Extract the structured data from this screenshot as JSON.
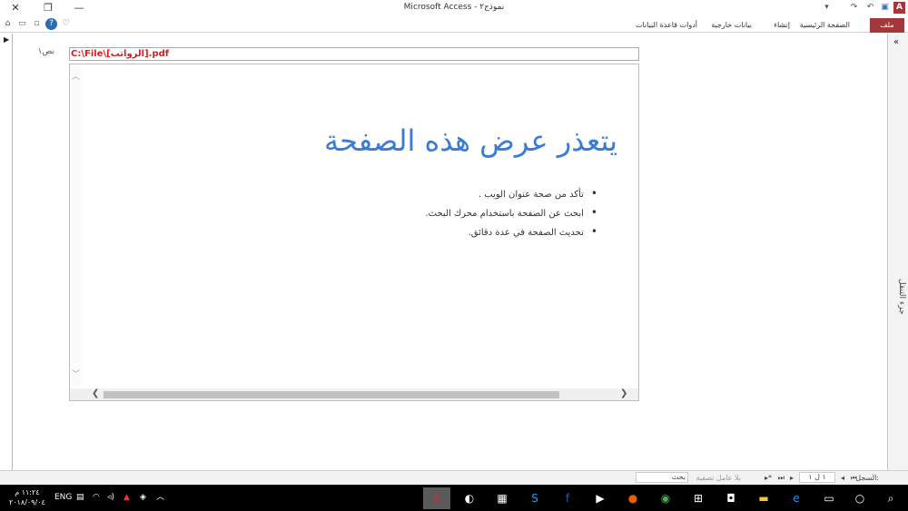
{
  "window": {
    "title": "Microsoft Access - نموذج٢"
  },
  "ribbon": {
    "tabs": [
      "ملف",
      "الصفحة الرئيسية",
      "إنشاء",
      "بيانات خارجية",
      "أدوات قاعدة البيانات"
    ]
  },
  "nav_pane": {
    "label": "جزء التنقل",
    "collapse": "«"
  },
  "form": {
    "label": "نص١",
    "path_value": "C:\\File\\[الرواتب].pdf",
    "error_title": "يتعذر عرض هذه الصفحة",
    "bullets": [
      "تأكد من صحة عنوان الويب  .",
      "ابحث عن الصفحة باستخدام محرك البحث.",
      "تحديث الصفحة في عدة دقائق."
    ]
  },
  "record_nav": {
    "label": "السجل:",
    "position": "١ ل ١",
    "filter": "بلا عامل تصفية",
    "search_placeholder": "بحث"
  },
  "taskbar": {
    "time": "١١:٢٤ م",
    "date": "٢٠١٨/٠٩/٠٤",
    "lang": "ENG"
  },
  "colors": {
    "accent": "#a4373a",
    "error_title": "#3a7bd5",
    "path_text": "#e21a1a"
  }
}
